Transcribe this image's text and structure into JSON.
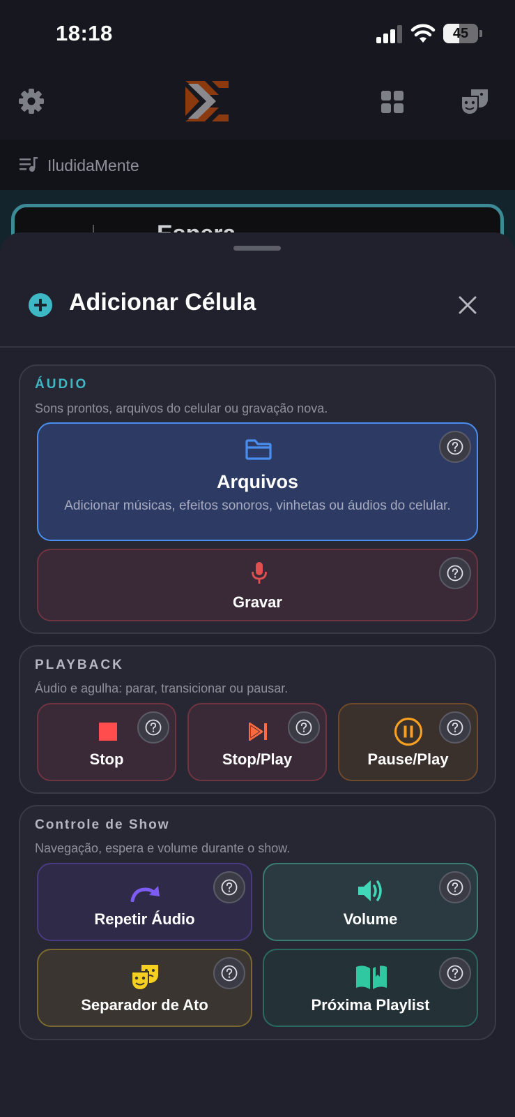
{
  "status_bar": {
    "time": "18:18",
    "battery_level": "45"
  },
  "app": {
    "playlist_name": "IludidaMente",
    "background_card_text": "Espera"
  },
  "sheet": {
    "title": "Adicionar Célula",
    "sections": {
      "audio": {
        "title": "ÁUDIO",
        "subtitle": "Sons prontos, arquivos do celular ou gravação nova.",
        "color": "#3fb8c6",
        "cards": {
          "files": {
            "label": "Arquivos",
            "description": "Adicionar músicas, efeitos sonoros, vinhetas ou áudios do celular."
          },
          "record": {
            "label": "Gravar"
          }
        }
      },
      "playback": {
        "title": "PLAYBACK",
        "subtitle": "Áudio e agulha: parar, transicionar ou pausar.",
        "cards": {
          "stop": {
            "label": "Stop"
          },
          "stop_play": {
            "label": "Stop/Play"
          },
          "pause_play": {
            "label": "Pause/Play"
          }
        }
      },
      "show_control": {
        "title": "Controle de Show",
        "subtitle": "Navegação, espera e volume durante o show.",
        "cards": {
          "repeat": {
            "label": "Repetir Áudio"
          },
          "volume": {
            "label": "Volume"
          },
          "act_separator": {
            "label": "Separador de Ato"
          },
          "next_playlist": {
            "label": "Próxima Playlist"
          }
        }
      }
    }
  },
  "icons": [
    "gear-icon",
    "app-logo",
    "grid-icon",
    "theater-masks-icon",
    "playlist-icon",
    "plus-circle-icon",
    "close-icon",
    "folder-icon",
    "microphone-icon",
    "stop-icon",
    "skip-next-icon",
    "pause-circle-icon",
    "redo-arrow-icon",
    "volume-icon",
    "theater-masks-icon",
    "open-book-icon",
    "help-icon"
  ],
  "colors": {
    "accent": "#3fb8c6",
    "files": "#4a8ff0",
    "record": "#e05050",
    "stop": "#ff4d4d",
    "pause": "#f5a020",
    "repeat": "#7c5cf2",
    "volume": "#40d8b8",
    "masks": "#f5d020",
    "book": "#30c8a0"
  }
}
